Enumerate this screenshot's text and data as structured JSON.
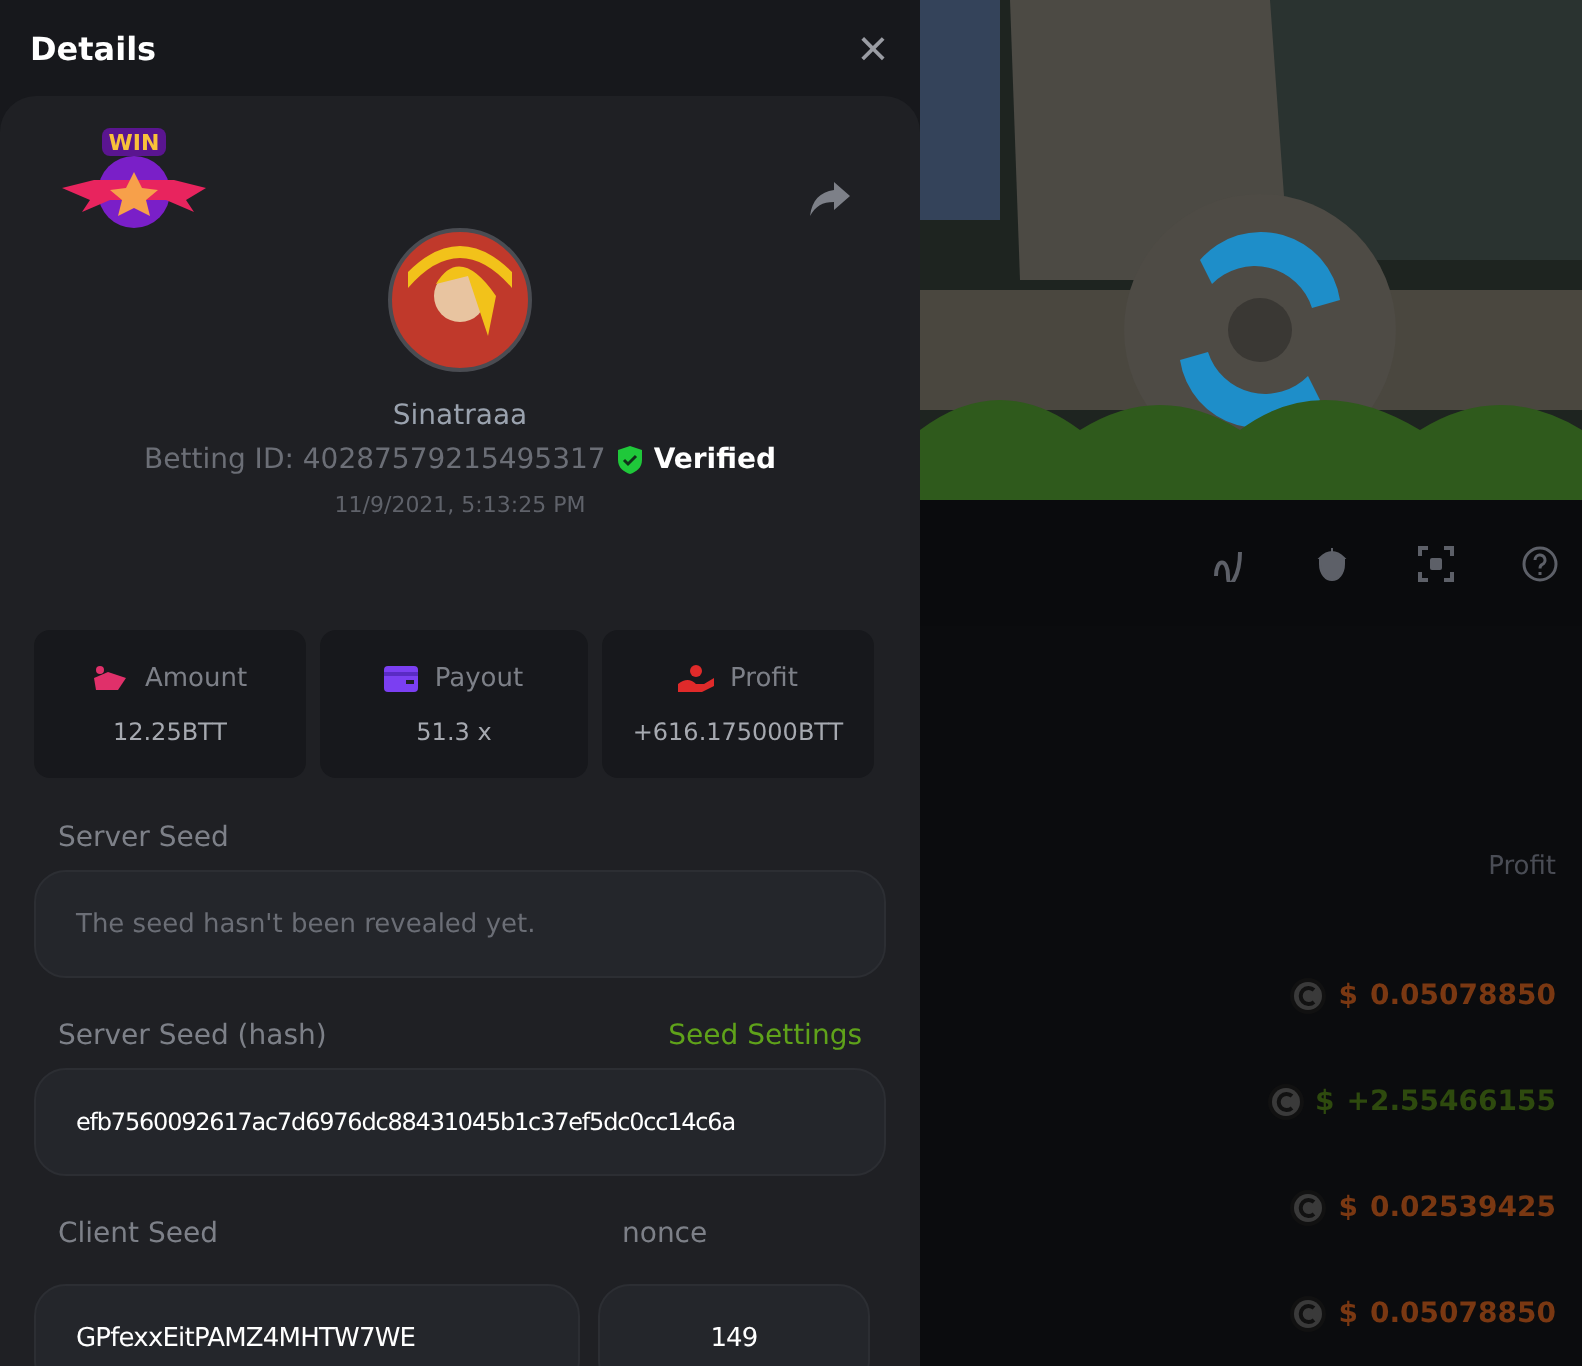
{
  "details": {
    "title": "Details",
    "close": "×",
    "badge": "WIN",
    "username": "Sinatraaa",
    "betting_id": "Betting ID: 40287579215495317",
    "verified": "Verified",
    "time": "11/9/2021, 5:13:25 PM",
    "stats": [
      {
        "kind": "amount",
        "label": "Amount",
        "value": "12.25BTT"
      },
      {
        "kind": "payout",
        "label": "Payout",
        "value": "51.3 x"
      },
      {
        "kind": "profit",
        "label": "Profit",
        "value": "+616.175000BTT"
      }
    ],
    "server_seed": {
      "label": "Server Seed",
      "placeholder": "The seed hasn't been revealed yet."
    },
    "server_seed_hash": {
      "label": "Server Seed (hash)",
      "link": "Seed Settings",
      "value": "efb7560092617ac7d6976dc88431045b1c37ef5dc0cc14c6a"
    },
    "client_seed": {
      "label": "Client Seed",
      "value": "GPfexxEitPAMZ4MHTW7WE"
    },
    "nonce": {
      "label": "nonce",
      "value": "149"
    }
  },
  "background": {
    "profit_header": "Profit",
    "rows": [
      {
        "currency": "$",
        "amount": "0.05078850",
        "color": "#7a3812"
      },
      {
        "currency": "$",
        "amount": "+2.55466155",
        "color": "#2e4a0e"
      },
      {
        "currency": "$",
        "amount": "0.02539425",
        "color": "#7a3812"
      },
      {
        "currency": "$",
        "amount": "0.05078850",
        "color": "#7a3812"
      }
    ]
  }
}
